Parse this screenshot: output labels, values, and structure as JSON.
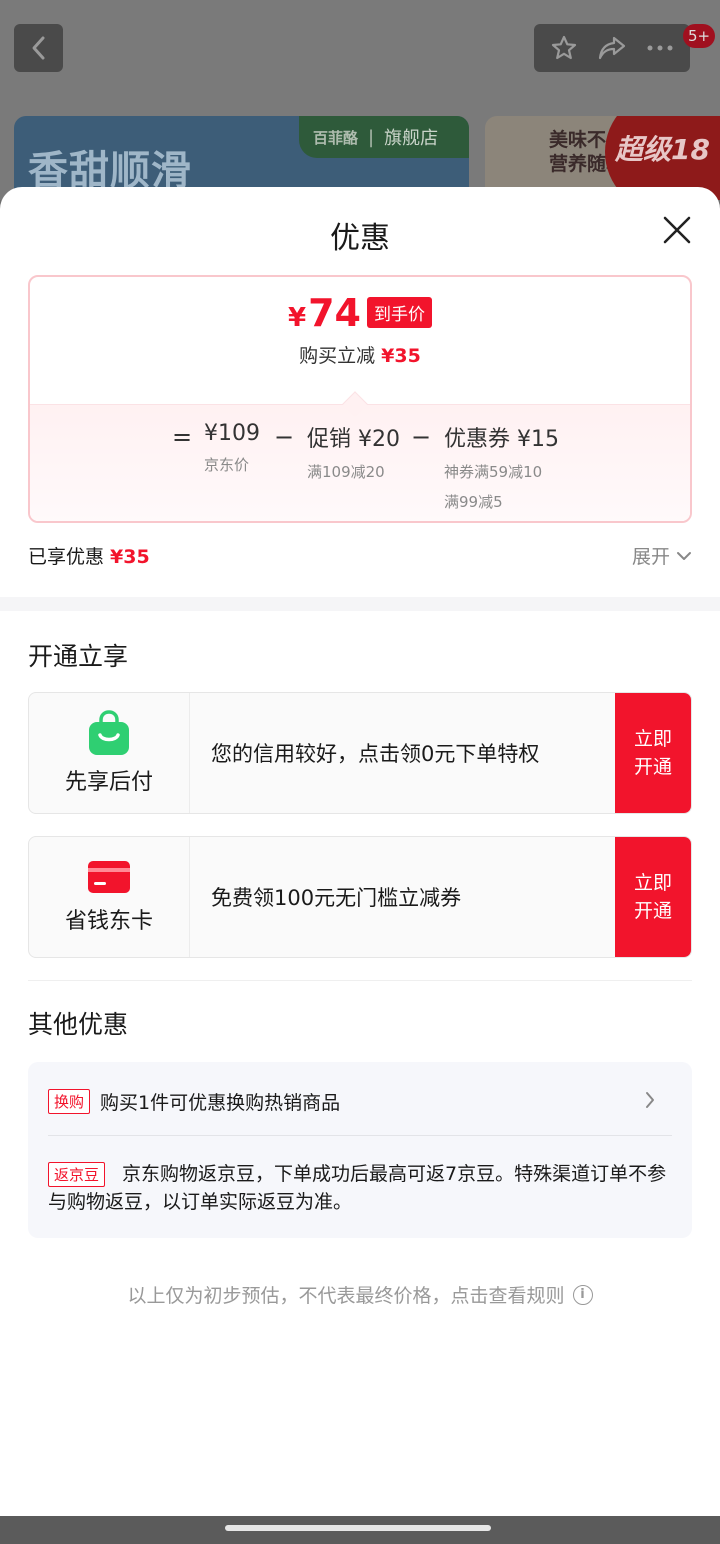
{
  "background": {
    "banner_left_slogan": "香甜顺滑",
    "banner_left_logo": "百菲酪",
    "banner_left_store": "旗舰店",
    "banner_right_text_1": "美味不",
    "banner_right_text_2": "营养随心",
    "banner_right_super": "超级18",
    "badge": "5+"
  },
  "sheet": {
    "title": "优惠"
  },
  "price_card": {
    "yen": "¥",
    "final_price": "74",
    "final_tag": "到手价",
    "save_label": "购买立减",
    "save_amount": "¥35",
    "equals": "=",
    "minus": "−",
    "jd_price": "¥109",
    "jd_price_label": "京东价",
    "promo": "促销 ¥20",
    "promo_desc": "满109减20",
    "coupon": "优惠券 ¥15",
    "coupon_desc_1": "神券满59减10",
    "coupon_desc_2": "满99减5"
  },
  "enjoyed": {
    "label": "已享优惠",
    "amount": "¥35",
    "expand": "展开"
  },
  "open_section": {
    "title": "开通立享",
    "cards": [
      {
        "name": "先享后付",
        "desc": "您的信用较好，点击领0元下单特权",
        "btn_line1": "立即",
        "btn_line2": "开通",
        "icon": "shopping-bag-icon",
        "color": "#2fcf72"
      },
      {
        "name": "省钱东卡",
        "desc": "免费领100元无门槛立减券",
        "btn_line1": "立即",
        "btn_line2": "开通",
        "icon": "card-icon",
        "color": "#f2142c"
      }
    ]
  },
  "other_section": {
    "title": "其他优惠",
    "items": [
      {
        "chip": "换购",
        "text": "购买1件可优惠换购热销商品"
      },
      {
        "chip": "返京豆",
        "text": "京东购物返京豆，下单成功后最高可返7京豆。特殊渠道订单不参与购物返豆，以订单实际返豆为准。"
      }
    ]
  },
  "footnote": "以上仅为初步预估，不代表最终价格，点击查看规则",
  "colors": {
    "accent": "#f2142c",
    "green": "#2fcf72"
  }
}
